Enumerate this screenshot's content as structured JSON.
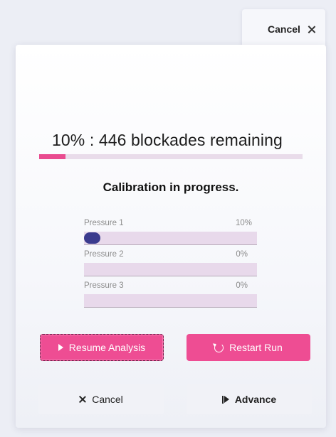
{
  "top_cancel": {
    "label": "Cancel"
  },
  "progress": {
    "percent_text": "10%",
    "separator": " : ",
    "remaining_text": "446 blockades remaining",
    "fraction": 0.1,
    "status": "Calibration in progress."
  },
  "pressures": [
    {
      "label": "Pressure 1",
      "value": "10%",
      "fraction": 0.1,
      "active": true
    },
    {
      "label": "Pressure 2",
      "value": "0%",
      "fraction": 0,
      "active": false
    },
    {
      "label": "Pressure 3",
      "value": "0%",
      "fraction": 0,
      "active": false
    }
  ],
  "actions": {
    "resume_label": "Resume Analysis",
    "restart_label": "Restart Run"
  },
  "footer": {
    "cancel_label": "Cancel",
    "advance_label": "Advance"
  },
  "colors": {
    "accent": "#ee4d93",
    "knob": "#3b3b8e",
    "track": "#e8d9eb"
  }
}
